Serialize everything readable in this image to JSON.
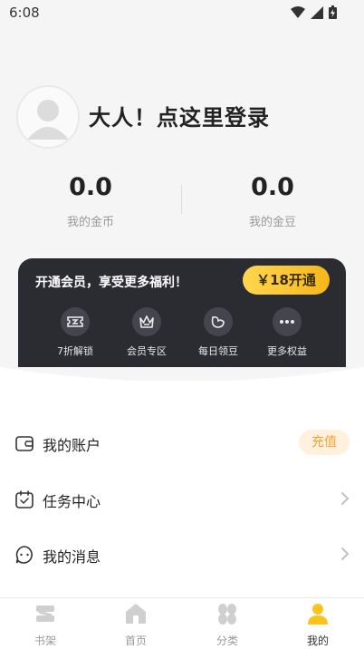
{
  "status_bar": {
    "time": "6:08"
  },
  "profile": {
    "login_text": "大人！点这里登录"
  },
  "stats": [
    {
      "value": "0.0",
      "label": "我的金币"
    },
    {
      "value": "0.0",
      "label": "我的金豆"
    }
  ],
  "vip": {
    "title": "开通会员，享受更多福利！",
    "button_label": "￥18开通",
    "benefits": [
      {
        "label": "7折解锁",
        "icon": "ticket-icon"
      },
      {
        "label": "会员专区",
        "icon": "crown-icon"
      },
      {
        "label": "每日领豆",
        "icon": "bean-icon"
      },
      {
        "label": "更多权益",
        "icon": "more-icon"
      }
    ]
  },
  "menu": [
    {
      "label": "我的账户",
      "icon": "wallet-icon",
      "action": "充值"
    },
    {
      "label": "任务中心",
      "icon": "calendar-icon"
    },
    {
      "label": "我的消息",
      "icon": "message-icon"
    }
  ],
  "tabs": [
    {
      "label": "书架",
      "icon": "bookshelf-icon",
      "active": false
    },
    {
      "label": "首页",
      "icon": "home-icon",
      "active": false
    },
    {
      "label": "分类",
      "icon": "category-icon",
      "active": false
    },
    {
      "label": "我的",
      "icon": "user-icon",
      "active": true
    }
  ],
  "colors": {
    "accent": "#f5b71b",
    "vip_card": "#2b2b32",
    "recharge_text": "#f2a233",
    "active_tab_icon": "#ffc21a",
    "inactive_tab_icon": "#cfcfcf"
  }
}
